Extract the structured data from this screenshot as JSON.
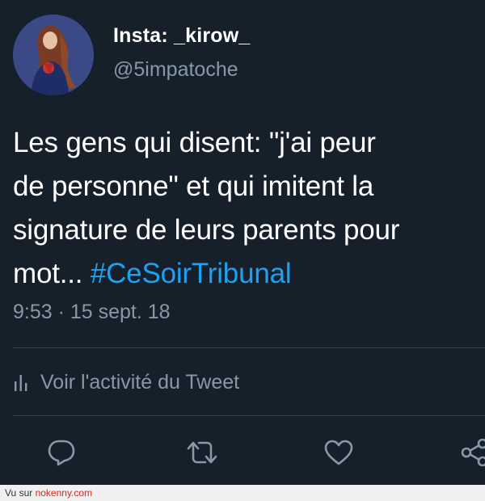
{
  "user": {
    "display_name": "Insta: _kirow_",
    "handle": "@5impatoche"
  },
  "tweet": {
    "text": "Les gens qui disent: \"j'ai peur\nde personne\" et qui imitent la\nsignature de leurs parents pour\nmot... ",
    "hashtag": "#CeSoirTribunal",
    "timestamp": "9:53 · 15 sept. 18"
  },
  "activity": {
    "label": "Voir l'activité du Tweet"
  },
  "actions": {
    "icons": [
      "reply-icon",
      "retweet-icon",
      "like-icon",
      "share-icon"
    ]
  },
  "footer": {
    "prefix": "Vu sur ",
    "link": "nokenny.com"
  },
  "colors": {
    "background": "#15202b",
    "accent": "#1da1f2",
    "secondary_text": "#8899a6",
    "divider": "#38444d"
  }
}
